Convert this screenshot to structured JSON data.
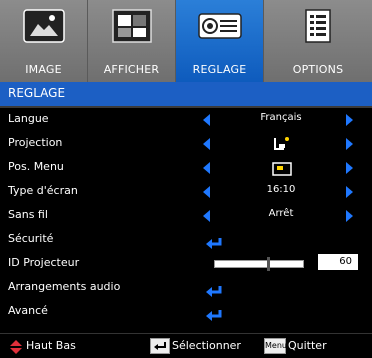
{
  "tabs": [
    {
      "label": "IMAGE",
      "icon": "image-icon",
      "active": false
    },
    {
      "label": "AFFICHER",
      "icon": "display-icon",
      "active": false
    },
    {
      "label": "REGLAGE",
      "icon": "projector-icon",
      "active": true
    },
    {
      "label": "OPTIONS",
      "icon": "options-icon",
      "active": false
    }
  ],
  "title": "REGLAGE",
  "rows": [
    {
      "name": "Langue",
      "value": "Français",
      "type": "select"
    },
    {
      "name": "Projection",
      "value": "",
      "type": "select-icon",
      "icon": "projection-front-icon"
    },
    {
      "name": "Pos. Menu",
      "value": "",
      "type": "select-icon",
      "icon": "menu-position-icon"
    },
    {
      "name": "Type d'écran",
      "value": "16:10",
      "type": "select"
    },
    {
      "name": "Sans fil",
      "value": "Arrêt",
      "type": "select"
    },
    {
      "name": "Sécurité",
      "type": "enter"
    },
    {
      "name": "ID Projecteur",
      "type": "slider",
      "value": "60",
      "level": 0.6
    },
    {
      "name": "Arrangements audio",
      "type": "enter"
    },
    {
      "name": "Avancé",
      "type": "enter"
    }
  ],
  "footer": {
    "nav_label": "Haut Bas",
    "select_label": "Sélectionner",
    "menu_key": "Menu",
    "quit_label": "Quitter"
  },
  "colors": {
    "accent": "#1c5fc4",
    "arrow": "#1f78ff",
    "nav": "#e0303b"
  }
}
